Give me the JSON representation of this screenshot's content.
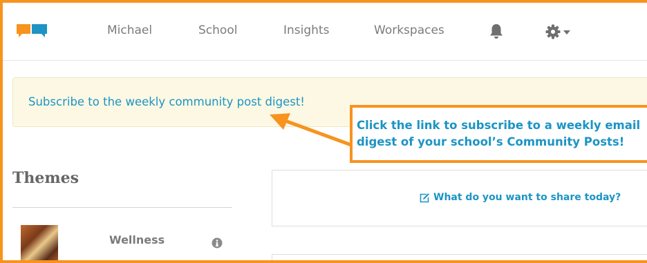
{
  "nav": {
    "items": [
      "Michael",
      "School",
      "Insights",
      "Workspaces"
    ]
  },
  "icons": {
    "logo": "chat-bubbles-logo",
    "notifications": "bell-icon",
    "settings": "gear-icon",
    "settings_caret": "caret-down-icon",
    "info": "info-circle-icon",
    "share": "edit-square-icon"
  },
  "banner": {
    "link_text": "Subscribe to the weekly community post digest!"
  },
  "callout": {
    "line1": "Click the link to subscribe to a weekly email",
    "line2": "digest of your school’s Community Posts!"
  },
  "themes": {
    "heading": "Themes",
    "items": [
      {
        "name": "Wellness"
      }
    ]
  },
  "share": {
    "prompt": "What do you want to share today?"
  },
  "colors": {
    "accent": "#1c94c4",
    "highlight": "#f7931e",
    "banner_bg": "#fcf8e3",
    "nav_text": "#7b7b7b"
  }
}
